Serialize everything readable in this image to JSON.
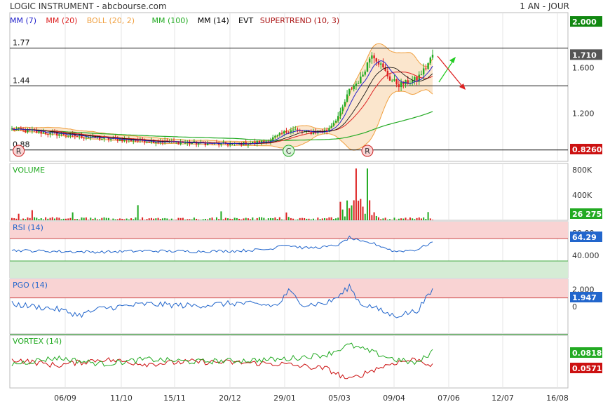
{
  "header": {
    "title": "LOGIC INSTRUMENT - abcbourse.com",
    "period": "1 AN - JOUR"
  },
  "legend": [
    {
      "label": "MM (7)",
      "color": "#2222cc"
    },
    {
      "label": "MM (20)",
      "color": "#dd2222"
    },
    {
      "label": "BOLL (20, 2)",
      "color": "#f0a040"
    },
    {
      "label": "MM (100)",
      "color": "#22aa22"
    },
    {
      "label": "MM (14)",
      "color": "#000000"
    },
    {
      "label": "EVT",
      "color": "#000000"
    },
    {
      "label": "SUPERTREND (10, 3)",
      "color": "#aa1111"
    }
  ],
  "colors": {
    "up": "#22aa22",
    "down": "#dd2222",
    "boll_fill": "#fbe3c8",
    "boll_line": "#f0a040",
    "rsi_line": "#2266cc",
    "overbought": "#f9d3d3",
    "oversold": "#d5ecd5",
    "vortex_plus": "#22aa22",
    "vortex_minus": "#cc1111"
  },
  "x_axis": {
    "labels": [
      "06/09",
      "11/10",
      "15/11",
      "20/12",
      "29/01",
      "05/03",
      "09/04",
      "07/06",
      "12/07",
      "16/08"
    ]
  },
  "chart_data": [
    {
      "type": "line",
      "name": "price",
      "ylim": [
        0.78,
        2.08
      ],
      "y_ticks": [
        2.0,
        1.6,
        1.2
      ],
      "y_tick_labels": [
        "2.000",
        "1.600",
        "1.200"
      ],
      "current_value_label": "1.710",
      "top_value_label": "2.000",
      "bottom_value_label": "0.8260",
      "horizontal_levels": [
        {
          "value": 1.77,
          "label": "1.77"
        },
        {
          "value": 1.44,
          "label": "1.44"
        },
        {
          "value": 0.88,
          "label": "0.88"
        }
      ],
      "events": [
        {
          "letter": "R",
          "index": 3
        },
        {
          "letter": "C",
          "index": 123
        },
        {
          "letter": "R",
          "index": 158
        }
      ],
      "keypoints": [
        [
          0,
          1.06
        ],
        [
          20,
          1.02
        ],
        [
          40,
          0.98
        ],
        [
          60,
          0.96
        ],
        [
          80,
          0.94
        ],
        [
          100,
          0.93
        ],
        [
          112,
          0.95
        ],
        [
          118,
          1.0
        ],
        [
          124,
          1.06
        ],
        [
          132,
          1.03
        ],
        [
          140,
          1.05
        ],
        [
          146,
          1.2
        ],
        [
          150,
          1.4
        ],
        [
          155,
          1.5
        ],
        [
          160,
          1.73
        ],
        [
          164,
          1.62
        ],
        [
          168,
          1.5
        ],
        [
          172,
          1.45
        ],
        [
          176,
          1.47
        ],
        [
          180,
          1.5
        ],
        [
          184,
          1.6
        ],
        [
          187,
          1.71
        ]
      ]
    },
    {
      "type": "bar",
      "name": "VOLUME",
      "ylim": [
        0,
        900000
      ],
      "y_ticks": [
        800000,
        400000
      ],
      "y_tick_labels": [
        "800K",
        "400K"
      ],
      "current_value_label": "26 275"
    },
    {
      "type": "line",
      "name": "RSI (14)",
      "ylim": [
        0,
        100
      ],
      "y_ticks": [
        80,
        40
      ],
      "y_tick_labels": [
        "80.00",
        "40.000"
      ],
      "overbought": 70,
      "oversold": 30,
      "current_value_label": "64.29",
      "keypoints": [
        [
          0,
          49
        ],
        [
          20,
          47
        ],
        [
          40,
          46
        ],
        [
          60,
          48
        ],
        [
          80,
          47
        ],
        [
          100,
          48
        ],
        [
          115,
          51
        ],
        [
          120,
          60
        ],
        [
          130,
          53
        ],
        [
          140,
          55
        ],
        [
          146,
          60
        ],
        [
          150,
          72
        ],
        [
          155,
          64
        ],
        [
          160,
          62
        ],
        [
          165,
          55
        ],
        [
          170,
          47
        ],
        [
          180,
          50
        ],
        [
          187,
          64
        ]
      ]
    },
    {
      "type": "line",
      "name": "PGO (14)",
      "ylim": [
        -3.2,
        3.2
      ],
      "y_ticks": [
        2.0,
        0
      ],
      "y_tick_labels": [
        "2.000",
        "0"
      ],
      "current_value_label": "1.947",
      "keypoints": [
        [
          0,
          0.3
        ],
        [
          20,
          -0.3
        ],
        [
          30,
          -1.0
        ],
        [
          40,
          -0.2
        ],
        [
          60,
          0.3
        ],
        [
          80,
          0.1
        ],
        [
          100,
          0.4
        ],
        [
          118,
          0.1
        ],
        [
          123,
          1.8
        ],
        [
          130,
          0.2
        ],
        [
          140,
          0.4
        ],
        [
          146,
          1.3
        ],
        [
          150,
          2.4
        ],
        [
          155,
          0.3
        ],
        [
          160,
          0.0
        ],
        [
          165,
          -0.6
        ],
        [
          170,
          -1.1
        ],
        [
          180,
          -0.5
        ],
        [
          187,
          1.9
        ]
      ]
    },
    {
      "type": "line",
      "name": "VORTEX (14)",
      "ylim": [
        0.45,
        1.55
      ],
      "current_value_label_plus": "0.0818",
      "current_value_label_minus": "0.0571",
      "keypoints_plus": [
        [
          0,
          0.95
        ],
        [
          20,
          1.08
        ],
        [
          40,
          0.95
        ],
        [
          60,
          1.05
        ],
        [
          80,
          1.0
        ],
        [
          100,
          1.02
        ],
        [
          120,
          1.05
        ],
        [
          140,
          1.15
        ],
        [
          150,
          1.35
        ],
        [
          160,
          1.2
        ],
        [
          170,
          1.05
        ],
        [
          180,
          0.96
        ],
        [
          187,
          1.22
        ]
      ],
      "keypoints_minus": [
        [
          0,
          1.05
        ],
        [
          20,
          0.92
        ],
        [
          40,
          1.05
        ],
        [
          60,
          0.95
        ],
        [
          80,
          1.0
        ],
        [
          100,
          0.98
        ],
        [
          120,
          0.95
        ],
        [
          140,
          0.85
        ],
        [
          150,
          0.62
        ],
        [
          160,
          0.82
        ],
        [
          170,
          0.98
        ],
        [
          180,
          1.05
        ],
        [
          187,
          0.92
        ]
      ]
    }
  ]
}
